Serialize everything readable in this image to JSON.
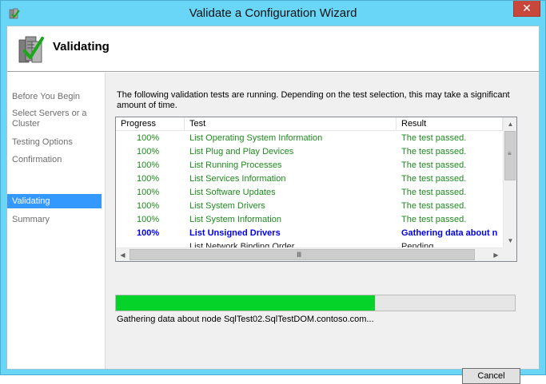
{
  "window": {
    "title": "Validate a Configuration Wizard",
    "close_glyph": "✕"
  },
  "header": {
    "title": "Validating"
  },
  "nav": {
    "items": [
      {
        "label": "Before You Begin",
        "active": false
      },
      {
        "label": "Select Servers or a Cluster",
        "active": false
      },
      {
        "label": "Testing Options",
        "active": false
      },
      {
        "label": "Confirmation",
        "active": false
      },
      {
        "label": "Validating",
        "active": true
      },
      {
        "label": "Summary",
        "active": false
      }
    ]
  },
  "content": {
    "description": "The following validation tests are running. Depending on the test selection, this may take a significant amount of time.",
    "columns": [
      "Progress",
      "Test",
      "Result"
    ],
    "rows": [
      {
        "progress": "100%",
        "test": "List Operating System Information",
        "result": "The test passed.",
        "state": "passed"
      },
      {
        "progress": "100%",
        "test": "List Plug and Play Devices",
        "result": "The test passed.",
        "state": "passed"
      },
      {
        "progress": "100%",
        "test": "List Running Processes",
        "result": "The test passed.",
        "state": "passed"
      },
      {
        "progress": "100%",
        "test": "List Services Information",
        "result": "The test passed.",
        "state": "passed"
      },
      {
        "progress": "100%",
        "test": "List Software Updates",
        "result": "The test passed.",
        "state": "passed"
      },
      {
        "progress": "100%",
        "test": "List System Drivers",
        "result": "The test passed.",
        "state": "passed"
      },
      {
        "progress": "100%",
        "test": "List System Information",
        "result": "The test passed.",
        "state": "passed"
      },
      {
        "progress": "100%",
        "test": "List Unsigned Drivers",
        "result": "Gathering data about n",
        "state": "running"
      },
      {
        "progress": "",
        "test": "List Network Binding Order",
        "result": "Pending",
        "state": "pending"
      }
    ],
    "progress_fraction": 0.65,
    "progress_color": "#06d32a",
    "status": "Gathering data about node SqlTest02.SqlTestDOM.contoso.com..."
  },
  "footer": {
    "cancel_label": "Cancel"
  },
  "icons": {
    "title": "cluster-wizard-icon",
    "header": "server-checkmark-icon"
  }
}
